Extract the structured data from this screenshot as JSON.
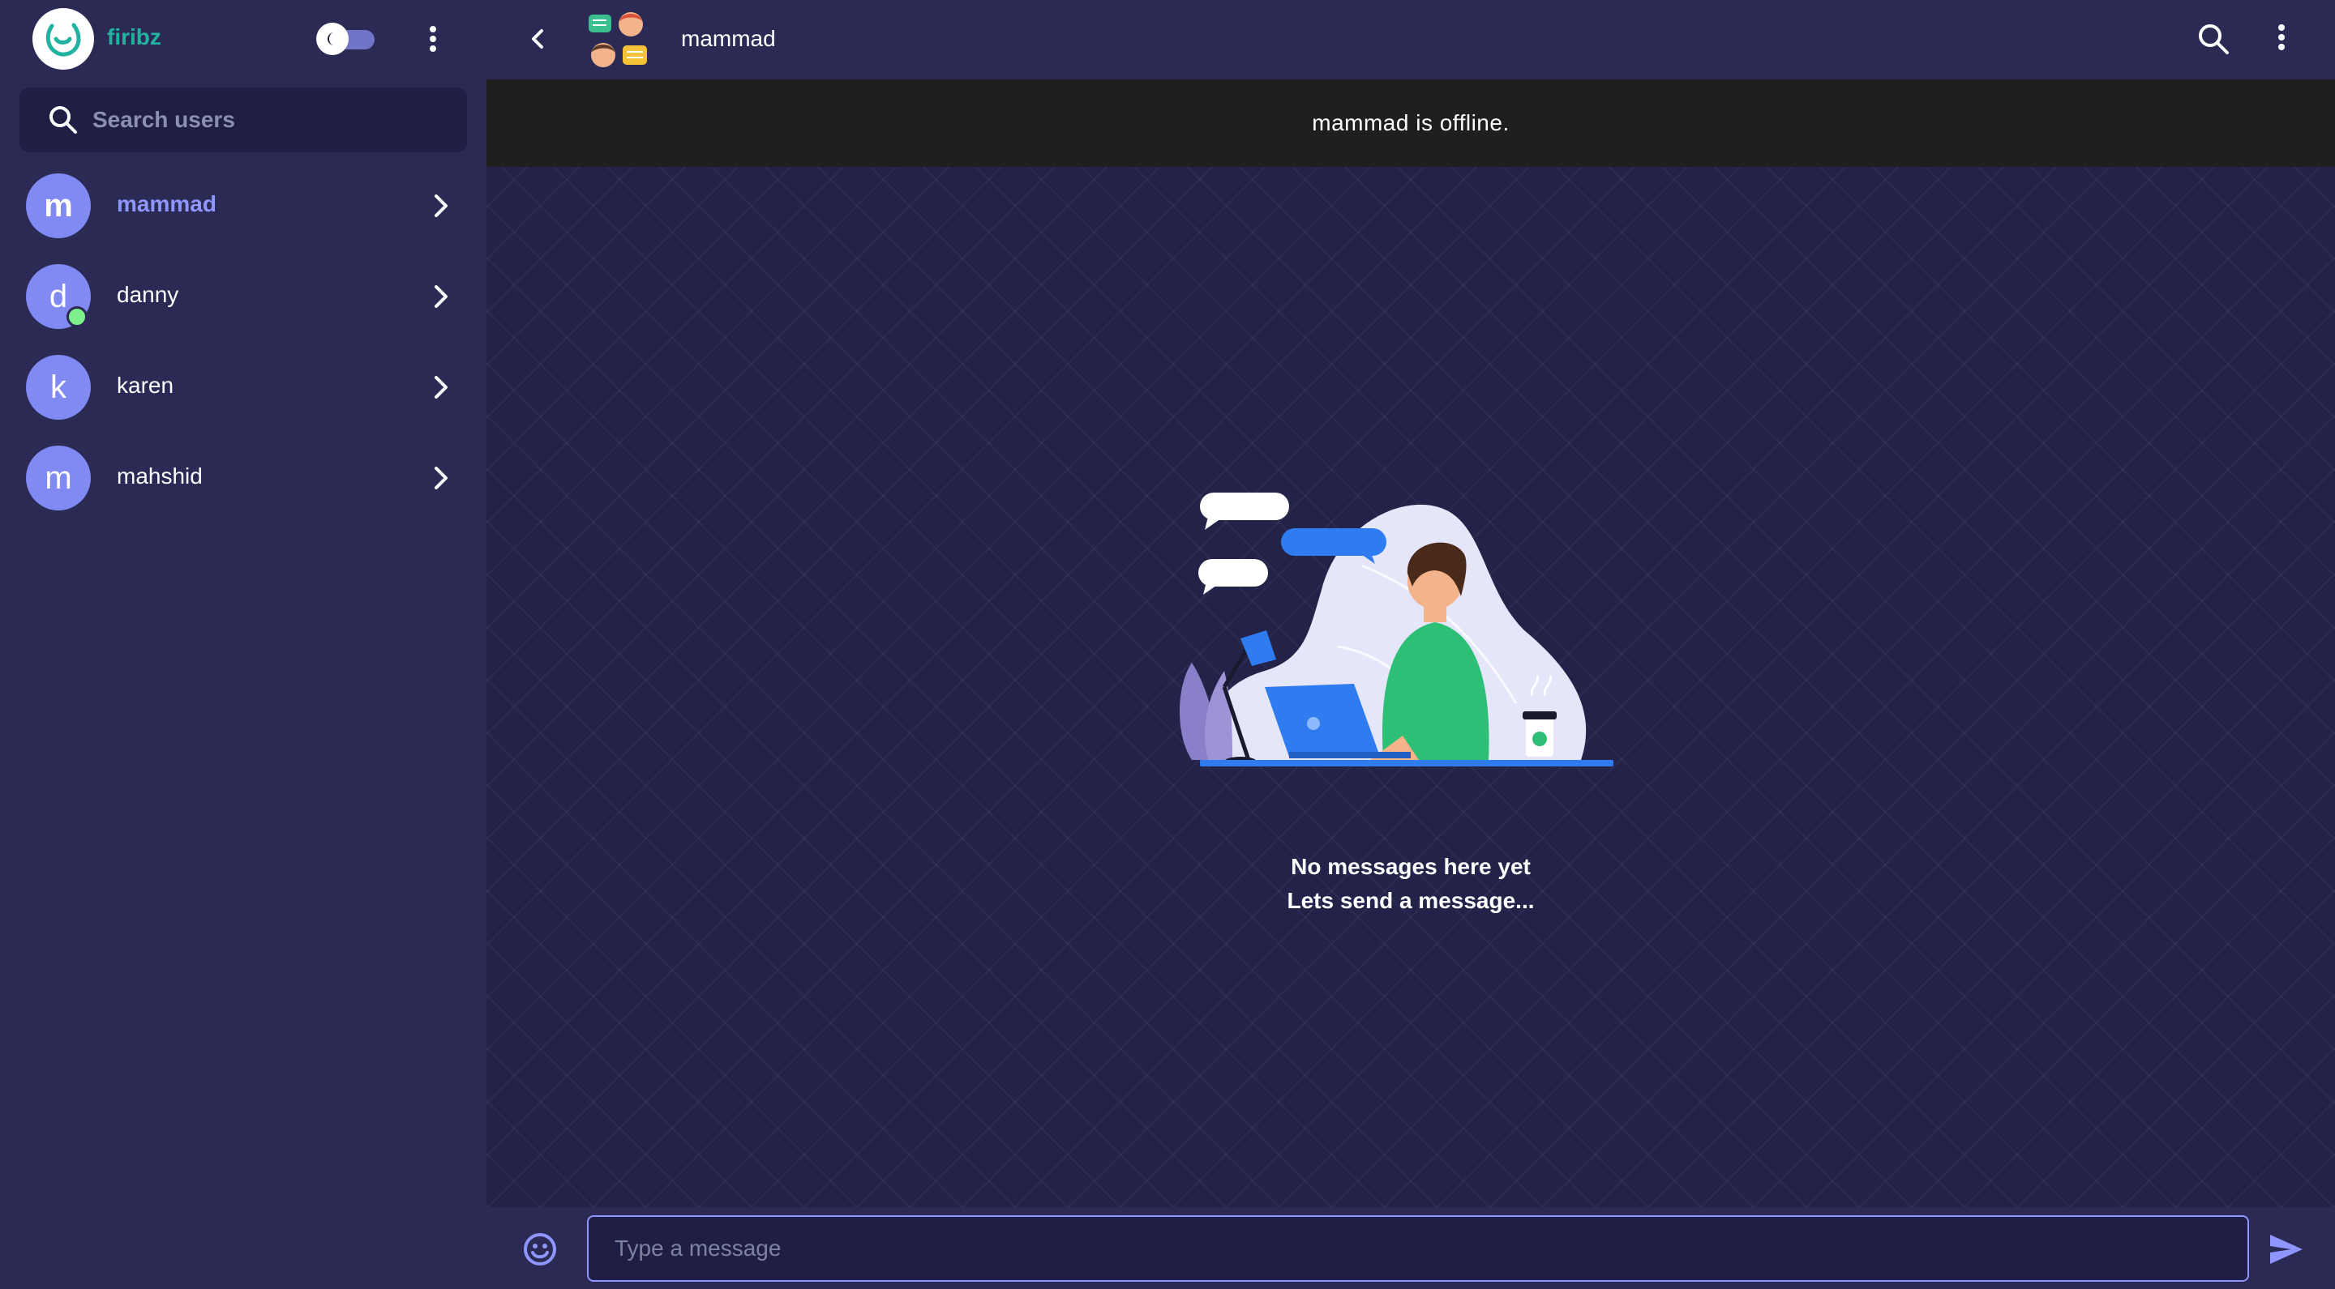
{
  "sidebar": {
    "brand": "firibz",
    "search": {
      "placeholder": "Search users",
      "value": ""
    },
    "users": [
      {
        "initial": "m",
        "name": "mammad",
        "active": true,
        "online": false
      },
      {
        "initial": "d",
        "name": "danny",
        "active": false,
        "online": true
      },
      {
        "initial": "k",
        "name": "karen",
        "active": false,
        "online": false
      },
      {
        "initial": "m",
        "name": "mahshid",
        "active": false,
        "online": false
      }
    ]
  },
  "chat": {
    "title": "mammad",
    "status_banner": "mammad is offline.",
    "empty_line1": "No messages here yet",
    "empty_line2": "Lets send a message...",
    "composer": {
      "placeholder": "Type a message",
      "value": ""
    }
  },
  "colors": {
    "accent": "#8f96ff",
    "avatar": "#8189f2",
    "brand": "#21b3a0",
    "online": "#7ef08a"
  },
  "icons": {
    "logo": "firibz-logo-icon",
    "toggle": "dark-mode-toggle",
    "menu": "more-vert-icon",
    "search": "search-icon",
    "chevron": "chevron-right-icon",
    "back": "chevron-left-icon",
    "emoji": "emoji-icon",
    "send": "send-icon"
  }
}
